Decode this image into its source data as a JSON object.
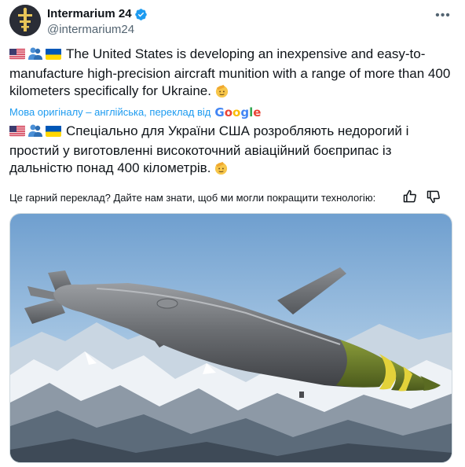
{
  "author": {
    "display_name": "Intermarium 24",
    "handle": "@intermarium24"
  },
  "post": {
    "text_en": "The United States is developing an inexpensive and  easy-to-manufacture high-precision aircraft munition with a range of  more than 400 kilometers specifically for Ukraine.",
    "translation_note": "Мова оригіналу – англійська, переклад від",
    "translation_brand": "Google",
    "text_uk": "Спеціально для України США розробляють недорогий і простий у виготовленні високоточний авіаційний боєприпас із дальністю понад 400 кілометрів."
  },
  "feedback": {
    "prompt": "Це гарний переклад? Дайте нам знати, щоб ми могли покращити технологію:"
  },
  "icons": {
    "verified": "verified-badge-icon",
    "more": "more-options-icon",
    "thumbs_up": "thumbs-up-icon",
    "thumbs_down": "thumbs-down-icon"
  },
  "colors": {
    "link_blue": "#1d9bf0",
    "text": "#0f1419",
    "secondary_text": "#536471",
    "missile_nose_green": "#6b7d2a",
    "missile_band_yellow": "#e3d23a"
  }
}
